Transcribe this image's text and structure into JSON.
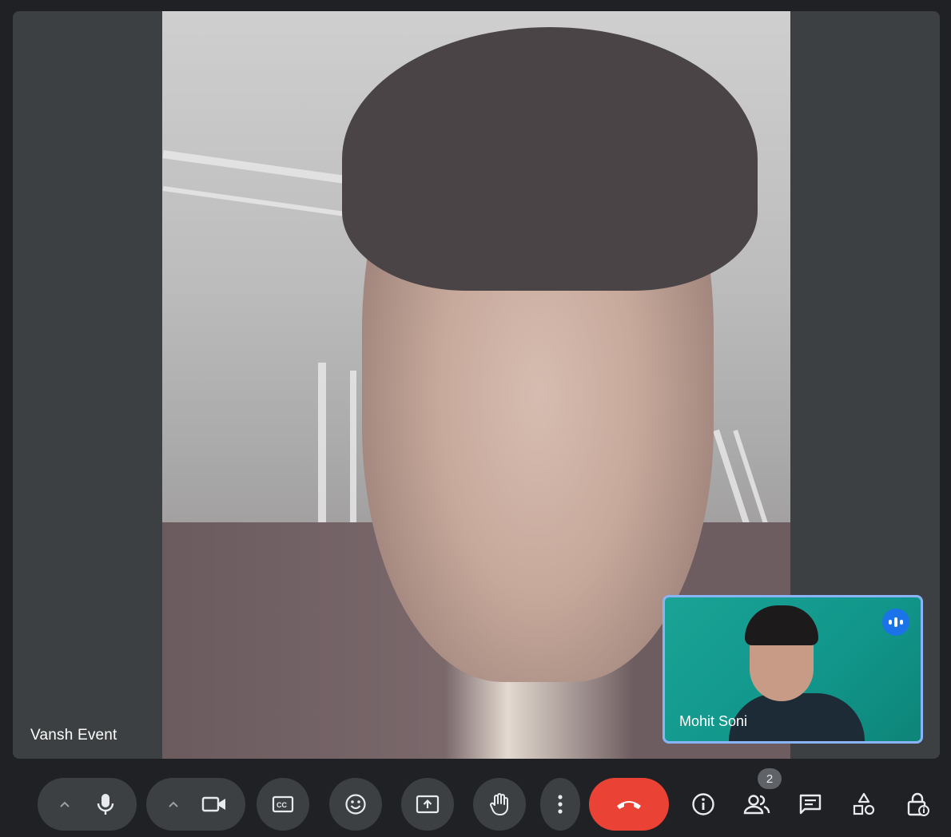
{
  "main_participant": {
    "name": "Vansh Event"
  },
  "self_view": {
    "name": "Mohit Soni",
    "speaking_icon": "audio-level-icon"
  },
  "toolbar": {
    "participant_count": "2",
    "accent_end_call": "#ea4335",
    "accent_selected_border": "#8ab4f8",
    "icons": [
      "chevron-up-icon",
      "microphone-icon",
      "chevron-up-icon",
      "camera-icon",
      "captions-icon",
      "emoji-icon",
      "present-screen-icon",
      "raise-hand-icon",
      "more-options-icon",
      "end-call-icon",
      "info-icon",
      "people-icon",
      "chat-icon",
      "activities-icon",
      "host-controls-icon"
    ]
  }
}
